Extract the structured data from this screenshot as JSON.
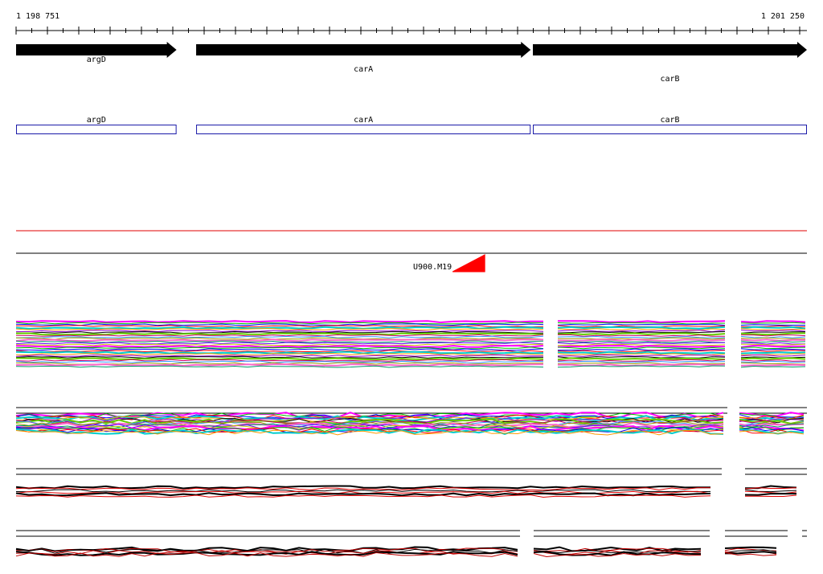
{
  "ruler": {
    "start_label": "1 198 751",
    "end_label": "1 201 250",
    "start": 1198751,
    "end": 1201250
  },
  "genes": [
    {
      "name": "argD",
      "start": 1198751,
      "end": 1199258
    },
    {
      "name": "carA",
      "start": 1199320,
      "end": 1200377
    },
    {
      "name": "carB",
      "start": 1200384,
      "end": 1201250
    }
  ],
  "cds": [
    {
      "name": "argD",
      "start": 1198751,
      "end": 1199258
    },
    {
      "name": "carA",
      "start": 1199320,
      "end": 1200377
    },
    {
      "name": "carB",
      "start": 1200384,
      "end": 1201250
    }
  ],
  "feature": {
    "label": "U900.M19",
    "position": 1200232
  },
  "colors": {
    "gene": "#000000",
    "cds_outline": "#1a1aa8",
    "red_line": "#e00000",
    "feature": "#ff0000"
  }
}
